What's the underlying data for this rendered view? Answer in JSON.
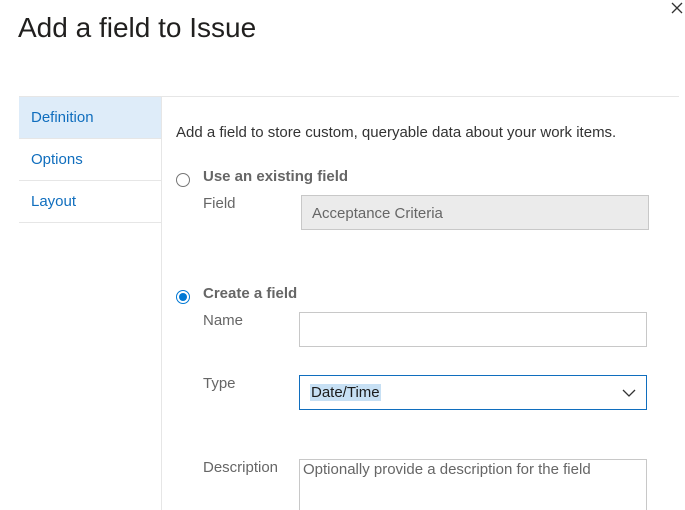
{
  "dialog": {
    "title": "Add a field to Issue",
    "close_icon": "close-icon"
  },
  "sidebar": {
    "items": [
      {
        "label": "Definition",
        "selected": true
      },
      {
        "label": "Options",
        "selected": false
      },
      {
        "label": "Layout",
        "selected": false
      }
    ]
  },
  "content": {
    "intro": "Add a field to store custom, queryable data about your work items.",
    "use_existing": {
      "label": "Use an existing field",
      "checked": false,
      "field_label": "Field",
      "field_value": "Acceptance Criteria"
    },
    "create": {
      "label": "Create a field",
      "checked": true,
      "name_label": "Name",
      "name_value": "",
      "type_label": "Type",
      "type_value": "Date/Time",
      "type_icon": "chevron-down-icon",
      "description_label": "Description",
      "description_placeholder": "Optionally provide a description for the field"
    }
  },
  "colors": {
    "accent": "#0078d4",
    "link": "#106ebe",
    "selected_bg": "#deecf9"
  }
}
